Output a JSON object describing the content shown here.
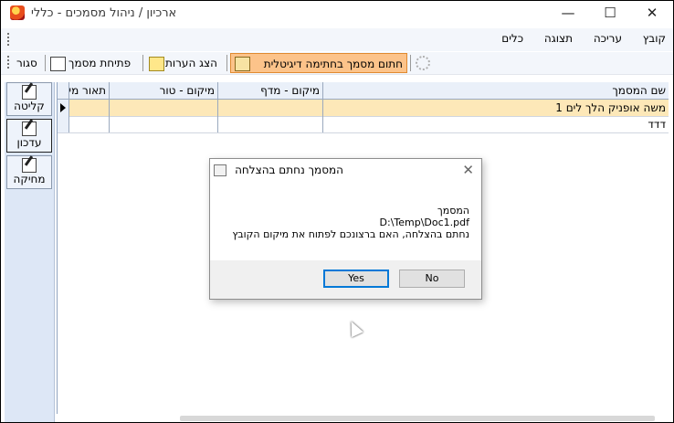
{
  "window": {
    "title": "ארכיון / ניהול מסמכים  - כללי",
    "minimize": "—",
    "maximize": "☐",
    "close": "✕"
  },
  "menu": {
    "items": [
      "קובץ",
      "עריכה",
      "תצוגה",
      "כלים"
    ]
  },
  "toolbar": {
    "sign": "חתום מסמך בחתימה דיגיטלית",
    "notes": "הצג הערות",
    "open": "פתיחת מסמך",
    "close": "סגור"
  },
  "side": {
    "add": "קליטה",
    "update": "עדכון",
    "delete": "מחיקה"
  },
  "grid": {
    "columns": [
      "שם המסמך",
      "מיקום - מדף",
      "מיקום - טור",
      "תאור מי"
    ],
    "rows": [
      [
        "משה אופניק הלך לים 1",
        "",
        "",
        ""
      ],
      [
        "דדד",
        "",
        "",
        ""
      ]
    ]
  },
  "dialog": {
    "title": "המסמך נחתם בהצלחה",
    "line1": "המסמך",
    "line2": "D:\\Temp\\Doc1.pdf",
    "line3": "נחתם בהצלחה, האם ברצונכם לפתוח את מיקום הקובץ",
    "yes": "Yes",
    "no": "No",
    "close_glyph": "✕"
  }
}
